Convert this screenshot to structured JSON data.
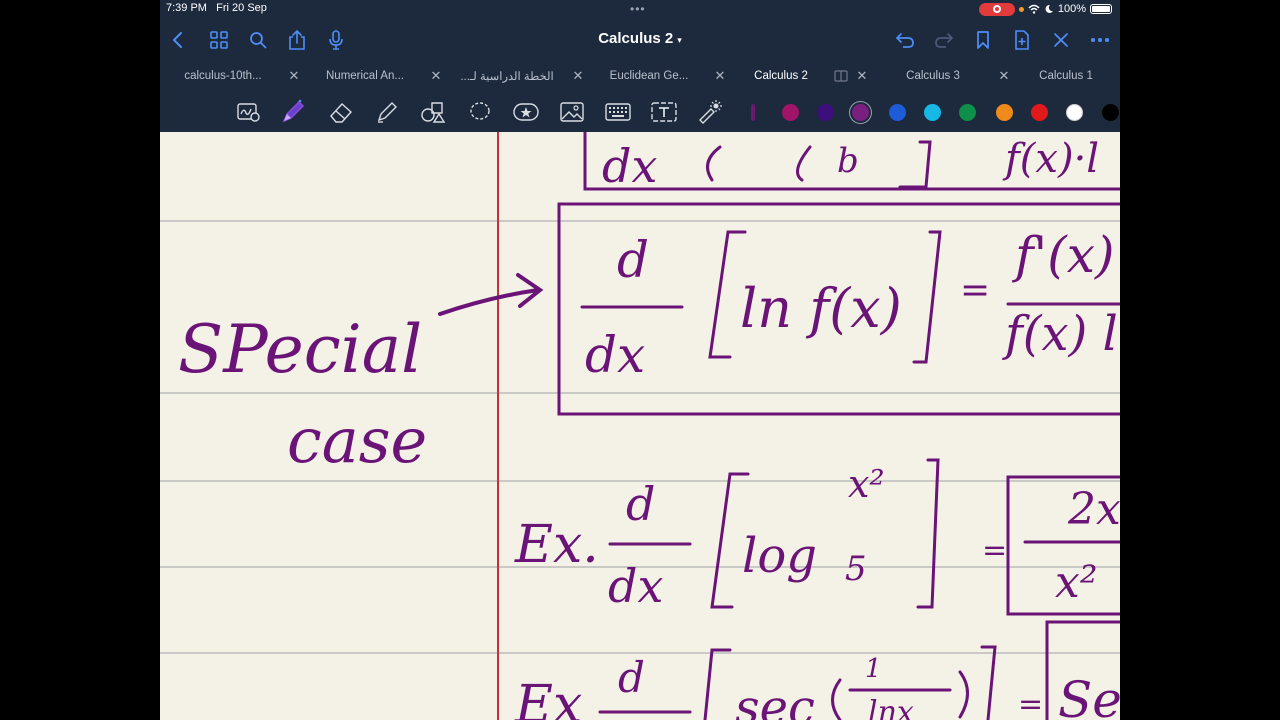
{
  "status": {
    "time": "7:39 PM",
    "date": "Fri 20 Sep",
    "battery": "100%",
    "accent": "#e23b3b"
  },
  "header": {
    "title": "Calculus 2"
  },
  "icons": {
    "left": [
      "back-icon",
      "thumbnails-icon",
      "search-icon",
      "share-icon",
      "microphone-icon"
    ],
    "right": [
      "undo-icon",
      "redo-icon",
      "bookmark-icon",
      "add-page-icon",
      "close-icon",
      "more-icon"
    ]
  },
  "tabs": [
    {
      "label": "calculus-10th...",
      "active": false
    },
    {
      "label": "Numerical An...",
      "active": false
    },
    {
      "label": "الخطة الدراسية لـ...",
      "active": false
    },
    {
      "label": "Euclidean Ge...",
      "active": false
    },
    {
      "label": "Calculus 2",
      "active": true
    },
    {
      "label": "Calculus 3",
      "active": false
    },
    {
      "label": "Calculus 1",
      "active": false
    }
  ],
  "tools": [
    "handwriting-to-text-icon",
    "pen-icon",
    "eraser-icon",
    "highlighter-icon",
    "shapes-icon",
    "lasso-icon",
    "sticker-icon",
    "image-icon",
    "keyboard-icon",
    "text-box-icon",
    "laser-pointer-icon"
  ],
  "colors": [
    "#6b1a6e",
    "#a0146a",
    "#3d0f7a",
    "#7a1f7f",
    "#1e5bd6",
    "#17b7e6",
    "#0f8f4a",
    "#f08a1a",
    "#e01a1a",
    "#ffffff",
    "#000000"
  ],
  "selected_color": "#7a1f7f",
  "ink_color": "#6b1477",
  "notes": {
    "left": [
      "SPecial",
      "case"
    ],
    "formula1": {
      "d": "d",
      "dx": "dx",
      "body": "ln f(x)",
      "rhs_num": "f'(x)",
      "rhs_den": "f(x) l"
    },
    "example1": {
      "prefix": "Ex.",
      "d": "d",
      "dx": "dx",
      "log": "log",
      "base": "5",
      "exp": "x²",
      "eq": "=",
      "num": "2x",
      "den": "x²"
    },
    "example2": {
      "prefix": "Ex",
      "d": "d",
      "body": "sec",
      "inner_num": "1",
      "inner_den": "lnx",
      "eq": "=",
      "ans": "Se"
    },
    "top_partial": {
      "dx": "dx",
      "bound": "b",
      "rhs": "f(x)·l"
    }
  }
}
